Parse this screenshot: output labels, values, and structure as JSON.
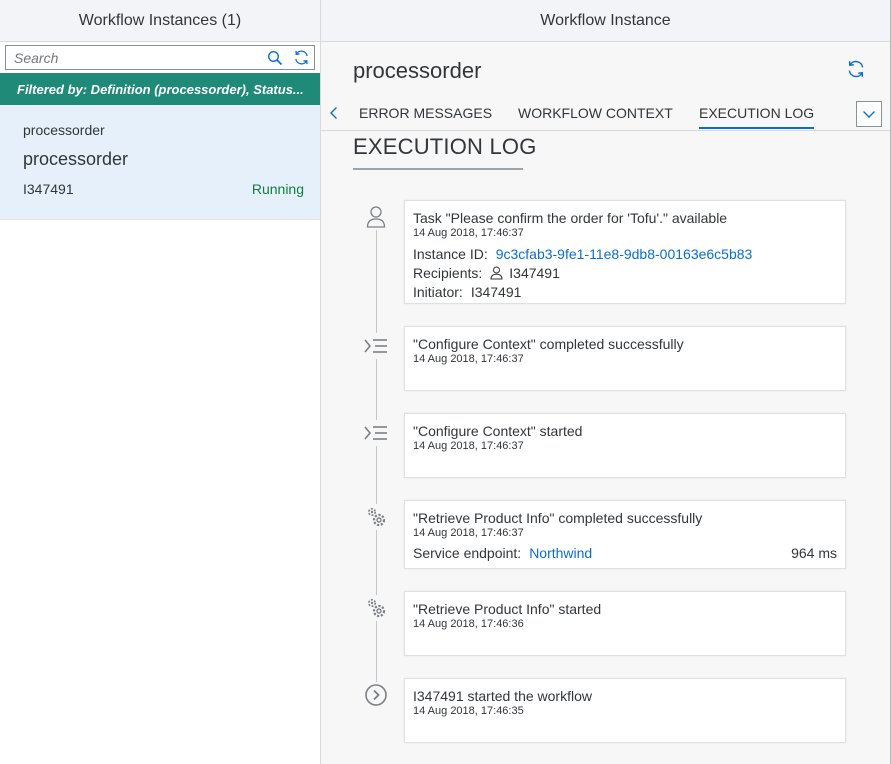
{
  "master": {
    "title": "Workflow Instances (1)",
    "search_placeholder": "Search",
    "filter_text": "Filtered by: Definition (processorder), Status...",
    "items": [
      {
        "intro": "processorder",
        "title": "processorder",
        "id": "I347491",
        "status": "Running"
      }
    ]
  },
  "detail": {
    "title": "Workflow Instance",
    "object_title": "processorder",
    "tabs": [
      "ERROR MESSAGES",
      "WORKFLOW CONTEXT",
      "EXECUTION LOG"
    ],
    "active_tab": "EXECUTION LOG",
    "section_title": "EXECUTION LOG"
  },
  "log": [
    {
      "icon": "person-icon",
      "title": "Task \"Please confirm the order for 'Tofu'.\" available",
      "time": "14 Aug 2018, 17:46:37",
      "instance_label": "Instance ID:",
      "instance_id": "9c3cfab3-9fe1-11e8-9db8-00163e6c5b83",
      "recipients_label": "Recipients:",
      "recipients": "I347491",
      "initiator_label": "Initiator:",
      "initiator": "I347491"
    },
    {
      "icon": "script-icon",
      "title": "\"Configure Context\" completed successfully",
      "time": "14 Aug 2018, 17:46:37"
    },
    {
      "icon": "script-icon",
      "title": "\"Configure Context\" started",
      "time": "14 Aug 2018, 17:46:37"
    },
    {
      "icon": "gears-icon",
      "title": "\"Retrieve Product Info\" completed successfully",
      "time": "14 Aug 2018, 17:46:37",
      "endpoint_label": "Service endpoint:",
      "endpoint": "Northwind",
      "duration": "964 ms"
    },
    {
      "icon": "gears-icon",
      "title": "\"Retrieve Product Info\" started",
      "time": "14 Aug 2018, 17:46:36"
    },
    {
      "icon": "start-icon",
      "title": "I347491 started the workflow",
      "time": "14 Aug 2018, 17:46:35"
    }
  ],
  "colors": {
    "accent": "#0a6ed1",
    "filter_bar": "#1f8a78",
    "status_positive": "#107e3e",
    "selected_item": "#e5f0fa"
  }
}
